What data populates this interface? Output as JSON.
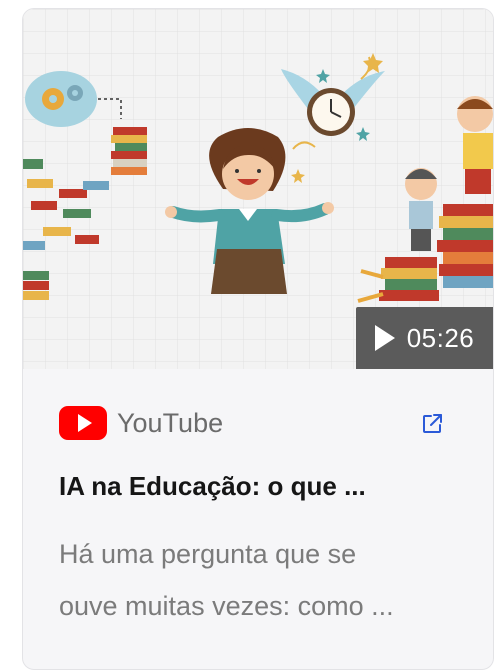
{
  "card": {
    "duration": "05:26",
    "source": {
      "name": "YouTube",
      "logo_icon": "youtube-icon",
      "link_icon": "external-link-icon"
    },
    "title": "IA na Educação: o que ...",
    "description_lines": [
      "Há uma pergunta que se",
      "ouve muitas vezes: como ..."
    ],
    "colors": {
      "youtube_red": "#ff0000",
      "link_blue": "#2b5ad8",
      "duration_bg": "#5b5b5b"
    }
  }
}
